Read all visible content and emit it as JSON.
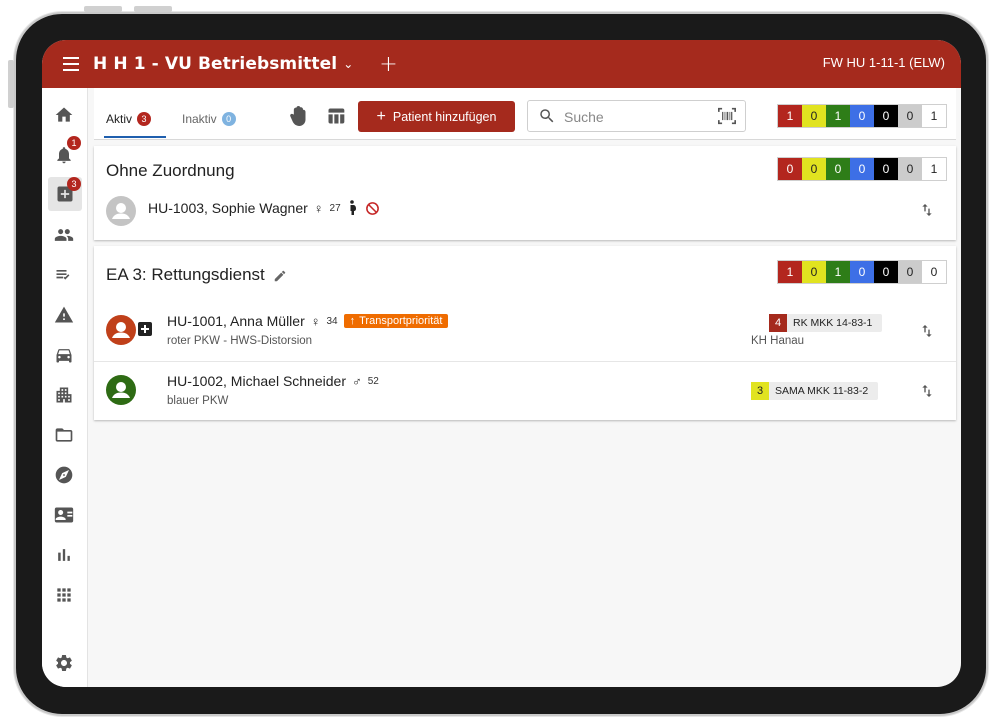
{
  "app": {
    "title": "H H 1 - VU Betriebsmittel",
    "chevron": "⌄",
    "plus": "+",
    "right_label": "FW HU 1-11-1 (ELW)"
  },
  "nav": {
    "alarm_badge": "1",
    "patients_badge": "3"
  },
  "tabs": {
    "active_label": "Aktiv",
    "active_count": "3",
    "inactive_label": "Inaktiv",
    "inactive_count": "0"
  },
  "toolbar": {
    "add_label": "Patient hinzufügen",
    "add_plus": "+",
    "search_placeholder": "Suche"
  },
  "colors": {
    "red": "#b3261e",
    "yellow": "#e1e320",
    "green": "#2e7d18",
    "blue": "#3d6fe6",
    "black": "#000000",
    "grey": "#cccccc",
    "white": "#ffffff"
  },
  "triage_total": [
    "1",
    "0",
    "1",
    "0",
    "0",
    "0",
    "1"
  ],
  "sections": [
    {
      "title": "Ohne Zuordnung",
      "triage": [
        "0",
        "0",
        "0",
        "0",
        "0",
        "0",
        "1"
      ],
      "patients": [
        {
          "name": "HU-1003, Sophie Wagner",
          "sex": "♀",
          "age": "27",
          "pregnant_icon": "pregnant-icon",
          "no_transport_icon": "no-symbol-icon"
        }
      ]
    },
    {
      "title": "EA 3: Rettungsdienst",
      "triage": [
        "1",
        "0",
        "1",
        "0",
        "0",
        "0",
        "0"
      ],
      "patients": [
        {
          "name": "HU-1001, Anna Müller",
          "sex": "♀",
          "age": "34",
          "priority": "Transportpriorität",
          "priority_arrow": "↑",
          "subtitle": "roter PKW - HWS-Distorsion",
          "unit_num": "4",
          "unit": "RK MKK 14-83-1",
          "hospital": "KH Hanau"
        },
        {
          "name": "HU-1002, Michael Schneider",
          "sex": "♂",
          "age": "52",
          "subtitle": "blauer PKW",
          "unit_num": "3",
          "unit": "SAMA MKK 11-83-2"
        }
      ]
    }
  ]
}
